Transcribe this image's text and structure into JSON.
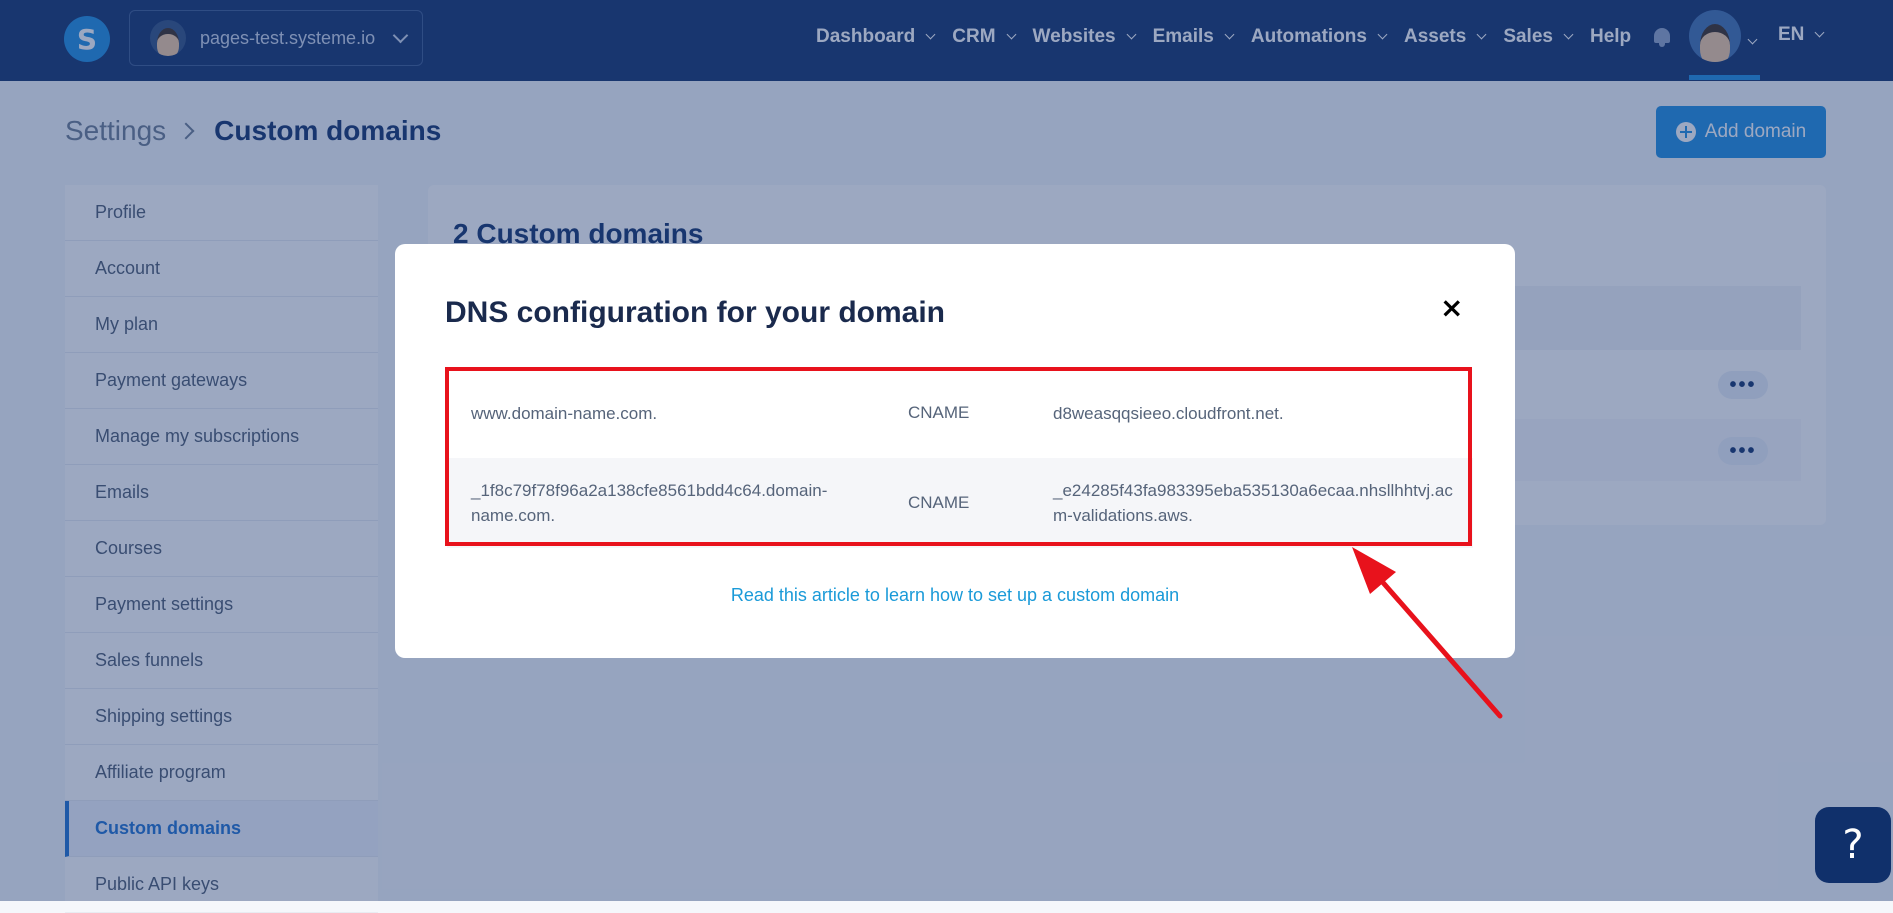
{
  "topbar": {
    "site_name": "pages-test.systeme.io",
    "logo_letter": "S",
    "nav": [
      "Dashboard",
      "CRM",
      "Websites",
      "Emails",
      "Automations",
      "Assets",
      "Sales",
      "Help"
    ],
    "language": "EN"
  },
  "header": {
    "breadcrumb_root": "Settings",
    "breadcrumb_current": "Custom domains",
    "add_button": "Add domain"
  },
  "sidebar": {
    "items": [
      "Profile",
      "Account",
      "My plan",
      "Payment gateways",
      "Manage my subscriptions",
      "Emails",
      "Courses",
      "Payment settings",
      "Sales funnels",
      "Shipping settings",
      "Affiliate program",
      "Custom domains",
      "Public API keys"
    ],
    "active": "Custom domains"
  },
  "content": {
    "title": "2 Custom domains",
    "row_menu": "•••"
  },
  "modal": {
    "title": "DNS configuration for your domain",
    "close": "×",
    "records": [
      {
        "host": "www.domain-name.com.",
        "type": "CNAME",
        "value": "d8weasqqsieeo.cloudfront.net."
      },
      {
        "host": "_1f8c79f78f96a2a138cfe8561bdd4c64.domain-name.com.",
        "type": "CNAME",
        "value": "_e24285f43fa983395eba535130a6ecaa.nhsllhhtvj.acm-validations.aws."
      }
    ],
    "link": "Read this article to learn how to set up a custom domain"
  },
  "help": "?",
  "colors": {
    "navy": "#10306b",
    "accent": "#1d8ce0",
    "highlight_red": "#e8121c",
    "link": "#1a9ad8"
  }
}
